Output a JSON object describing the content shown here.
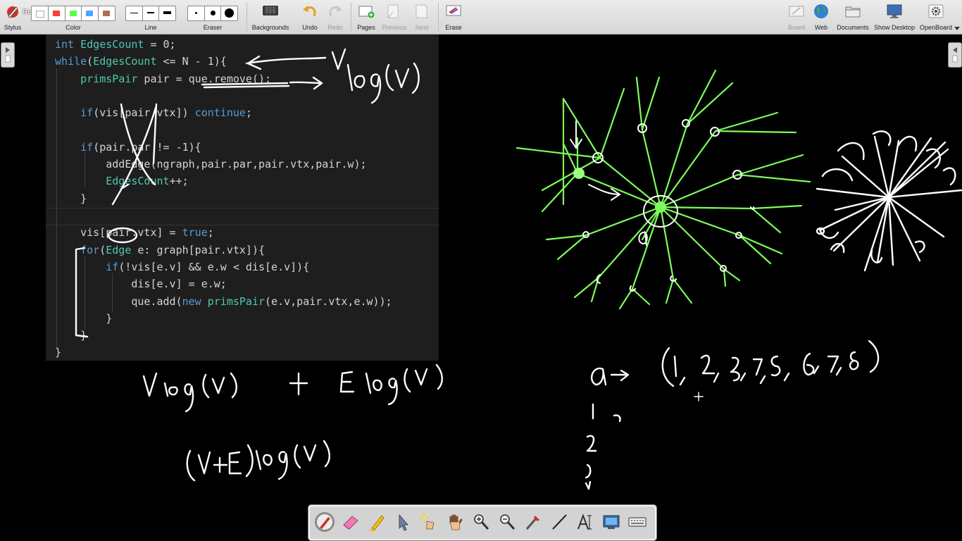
{
  "toolbar": {
    "recording_text": "Recording",
    "stylus_label": "Stylus",
    "color_label": "Color",
    "line_label": "Line",
    "eraser_label": "Eraser",
    "backgrounds_label": "Backgrounds",
    "undo_label": "Undo",
    "redo_label": "Redo",
    "pages_label": "Pages",
    "previous_label": "Previous",
    "next_label": "Next",
    "erase_label": "Erase",
    "board_label": "Board",
    "web_label": "Web",
    "documents_label": "Documents",
    "show_desktop_label": "Show Desktop",
    "openboard_label": "OpenBoard",
    "colors": [
      "#ffffff",
      "#ff3b3b",
      "#5cff4c",
      "#4aa8ff",
      "#b27050"
    ]
  },
  "code": {
    "lines": [
      "int EdgesCount = 0;",
      "while(EdgesCount <= N - 1){",
      "    primsPair pair = que.remove();",
      "",
      "    if(vis[pair.vtx]) continue;",
      "",
      "    if(pair.par != -1){",
      "        addEdge(ngraph,pair.par,pair.vtx,pair.w);",
      "        EdgesCount++;",
      "    }",
      "",
      "    vis[pair.vtx] = true;",
      "    for(Edge e: graph[pair.vtx]){",
      "        if(!vis[e.v] && e.w < dis[e.v]){",
      "            dis[e.v] = e.w;",
      "            que.add(new primsPair(e.v,pair.vtx,e.w));",
      "        }",
      "    }",
      "}"
    ]
  },
  "bottom_toolbar": {
    "tools": [
      "pen-icon",
      "eraser-icon",
      "marker-icon",
      "pointer-icon",
      "laser-icon",
      "hand-icon",
      "zoom-in-icon",
      "zoom-out-icon",
      "capture-icon",
      "line-icon",
      "text-icon",
      "screen-icon",
      "keyboard-icon"
    ]
  }
}
